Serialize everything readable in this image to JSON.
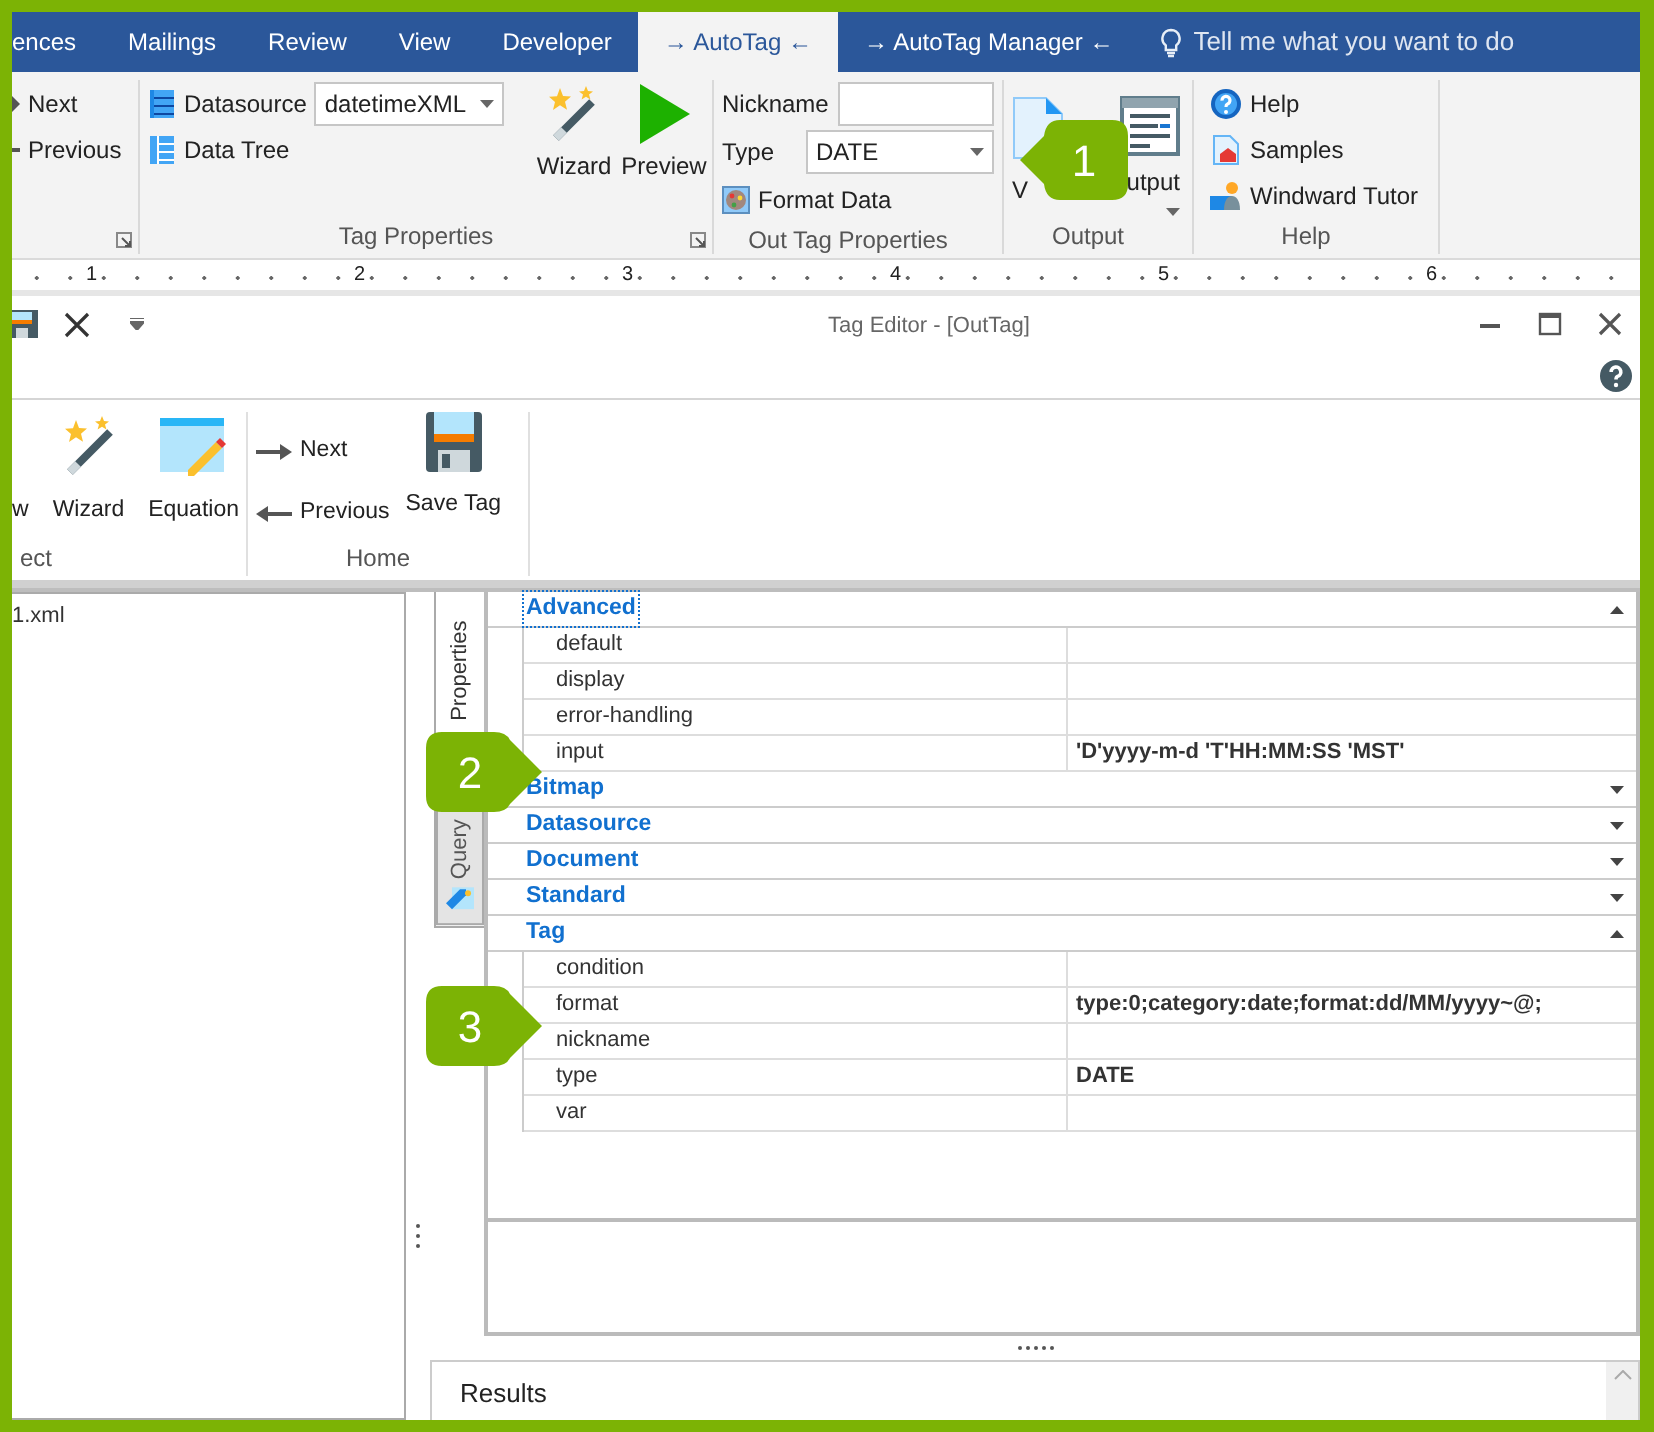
{
  "word_tabs": [
    {
      "label": "ences",
      "selected": false
    },
    {
      "label": "Mailings",
      "selected": false
    },
    {
      "label": "Review",
      "selected": false
    },
    {
      "label": "View",
      "selected": false
    },
    {
      "label": "Developer",
      "selected": false
    },
    {
      "label": "→ AutoTag ←",
      "selected": true
    },
    {
      "label": "→ AutoTag Manager ←",
      "selected": false
    }
  ],
  "tell_me": {
    "placeholder": "Tell me what you want to do"
  },
  "ribbon": {
    "nav": [
      "Next",
      "Previous"
    ],
    "tag_properties": {
      "label": "Tag Properties",
      "datasource_label": "Datasource",
      "datasource_value": "datetimeXML",
      "data_tree": "Data Tree",
      "wizard": "Wizard",
      "preview": "Preview"
    },
    "out_tag_properties": {
      "label": "Out Tag Properties",
      "nickname_label": "Nickname",
      "type_label": "Type",
      "type_value": "DATE",
      "format_data": "Format Data"
    },
    "output": {
      "label": "Output",
      "buttons": [
        "V",
        "utput"
      ]
    },
    "help": {
      "label": "Help",
      "items": [
        "Help",
        "Samples",
        "Windward Tutor"
      ]
    }
  },
  "ruler": [
    "1",
    "2",
    "3",
    "4",
    "5",
    "6"
  ],
  "editor": {
    "title": "Tag Editor - [OutTag]",
    "ribbon": {
      "select_group": {
        "label": "ect",
        "buttons": [
          "w",
          "Wizard",
          "Equation"
        ]
      },
      "home_group": {
        "label": "Home",
        "nav": [
          "Next",
          "Previous"
        ],
        "save": "Save Tag"
      }
    },
    "tree": [
      "1.xml"
    ],
    "side_tabs": [
      {
        "label": "Properties",
        "selected": true
      },
      {
        "label": "Query",
        "selected": false
      }
    ],
    "categories": [
      {
        "name": "Advanced",
        "expanded": true,
        "selected": true,
        "properties": [
          {
            "name": "default"
          },
          {
            "name": "display"
          },
          {
            "name": "error-handling"
          },
          {
            "name": "input",
            "value": "'D'yyyy-m-d 'T'HH:MM:SS 'MST'"
          }
        ]
      },
      {
        "name": "Bitmap",
        "expanded": false,
        "selected": false
      },
      {
        "name": "Datasource",
        "expanded": false,
        "selected": false
      },
      {
        "name": "Document",
        "expanded": false,
        "selected": false
      },
      {
        "name": "Standard",
        "expanded": false,
        "selected": false
      },
      {
        "name": "Tag",
        "expanded": true,
        "selected": false,
        "properties": [
          {
            "name": "condition"
          },
          {
            "name": "format",
            "value": "type:0;category:date;format:dd/MM/yyyy~@;"
          },
          {
            "name": "nickname"
          },
          {
            "name": "type",
            "value": "DATE"
          },
          {
            "name": "var"
          }
        ]
      }
    ],
    "results": "Results"
  },
  "callouts": [
    "1",
    "2",
    "3"
  ]
}
